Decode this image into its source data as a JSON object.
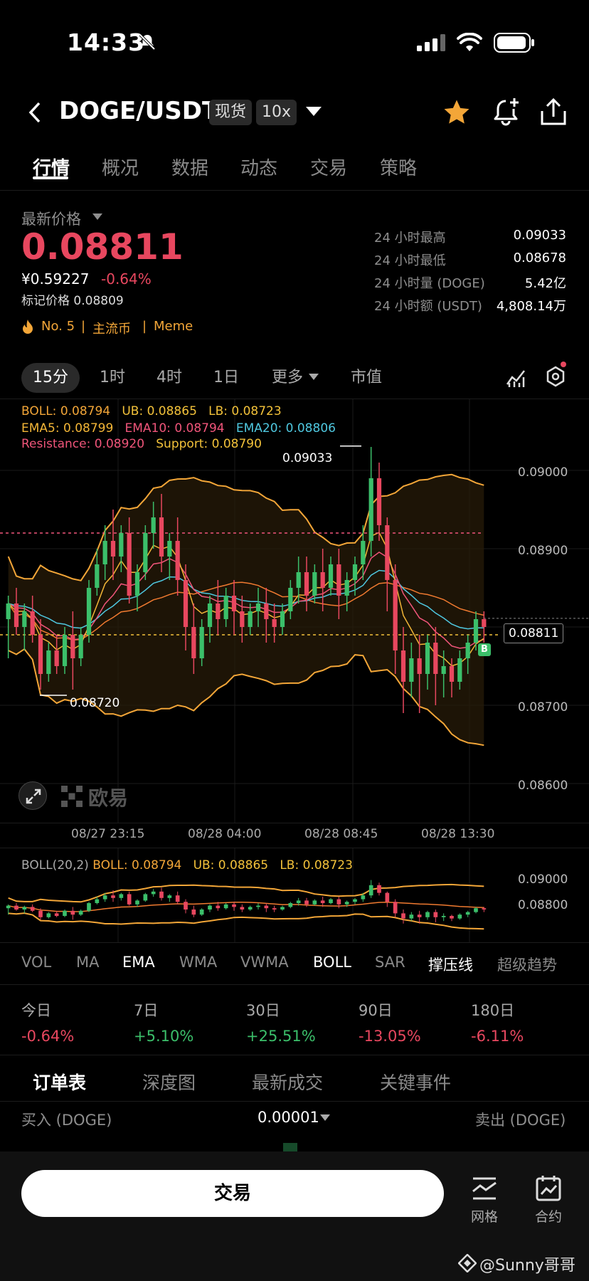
{
  "status_bar": {
    "time": "14:33"
  },
  "header": {
    "pair": "DOGE/USDT",
    "market_chip": "现货",
    "leverage_chip": "10x",
    "favorite_color": "#f3a638"
  },
  "tabs": [
    "行情",
    "概况",
    "数据",
    "动态",
    "交易",
    "策略"
  ],
  "price": {
    "label": "最新价格",
    "last": "0.08811",
    "cny": "¥0.59227",
    "change": "-0.64%",
    "mark_label": "标记价格 0.08809",
    "rank": "No. 5",
    "tag1": "主流币",
    "tag2": "Meme",
    "sep": "|"
  },
  "stats": [
    {
      "k": "24 小时最高",
      "v": "0.09033"
    },
    {
      "k": "24 小时最低",
      "v": "0.08678"
    },
    {
      "k": "24 小时量 (DOGE)",
      "v": "5.42亿"
    },
    {
      "k": "24 小时额 (USDT)",
      "v": "4,808.14万"
    }
  ],
  "timeframes": [
    "15分",
    "1时",
    "4时",
    "1日",
    "更多",
    "市值"
  ],
  "legend": {
    "boll": "BOLL: 0.08794",
    "ub": "UB: 0.08865",
    "lb": "LB: 0.08723",
    "ema5": "EMA5: 0.08799",
    "ema10": "EMA10: 0.08794",
    "ema20": "EMA20: 0.08806",
    "resistance": "Resistance: 0.08920",
    "support": "Support: 0.08790"
  },
  "chart_data": {
    "type": "candlestick",
    "y_ticks": [
      "0.09000",
      "0.08900",
      "0.08800",
      "0.08700",
      "0.08600"
    ],
    "x_ticks": [
      "08/27 23:15",
      "08/28 04:00",
      "08/28 08:45",
      "08/28 13:30"
    ],
    "high_label": "0.09033",
    "low_label": "0.08720",
    "current_price_label": "0.08811",
    "resistance": 0.0892,
    "support": 0.0879,
    "watermark": "欧易",
    "marker": "B",
    "candles": [
      [
        0.0881,
        0.0884,
        0.0883,
        0.0876
      ],
      [
        0.0883,
        0.0885,
        0.088,
        0.0879
      ],
      [
        0.088,
        0.0883,
        0.0882,
        0.0877
      ],
      [
        0.0882,
        0.0884,
        0.0879,
        0.0878
      ],
      [
        0.0879,
        0.0881,
        0.0874,
        0.0872
      ],
      [
        0.0874,
        0.0878,
        0.0877,
        0.0873
      ],
      [
        0.0877,
        0.0879,
        0.0875,
        0.0874
      ],
      [
        0.0875,
        0.088,
        0.0879,
        0.0874
      ],
      [
        0.0879,
        0.0882,
        0.0876,
        0.0872
      ],
      [
        0.0876,
        0.088,
        0.0879,
        0.0875
      ],
      [
        0.0879,
        0.0886,
        0.0885,
        0.0878
      ],
      [
        0.0885,
        0.089,
        0.0888,
        0.0884
      ],
      [
        0.0888,
        0.0893,
        0.0891,
        0.0886
      ],
      [
        0.0891,
        0.0895,
        0.0889,
        0.0886
      ],
      [
        0.0889,
        0.0893,
        0.0892,
        0.0887
      ],
      [
        0.0892,
        0.0894,
        0.0884,
        0.0883
      ],
      [
        0.0884,
        0.0888,
        0.0887,
        0.0882
      ],
      [
        0.0887,
        0.0893,
        0.0892,
        0.0886
      ],
      [
        0.0892,
        0.0896,
        0.0894,
        0.089
      ],
      [
        0.0894,
        0.0897,
        0.0889,
        0.0887
      ],
      [
        0.0889,
        0.0892,
        0.0891,
        0.0886
      ],
      [
        0.0891,
        0.0894,
        0.0886,
        0.0884
      ],
      [
        0.0886,
        0.0888,
        0.088,
        0.0877
      ],
      [
        0.088,
        0.0883,
        0.0876,
        0.0874
      ],
      [
        0.0876,
        0.0881,
        0.088,
        0.0875
      ],
      [
        0.088,
        0.0884,
        0.0883,
        0.0878
      ],
      [
        0.0883,
        0.0886,
        0.0881,
        0.0879
      ],
      [
        0.0881,
        0.0885,
        0.0884,
        0.088
      ],
      [
        0.0884,
        0.0886,
        0.0882,
        0.0879
      ],
      [
        0.0882,
        0.0884,
        0.088,
        0.0878
      ],
      [
        0.088,
        0.0883,
        0.0882,
        0.0879
      ],
      [
        0.0882,
        0.0885,
        0.0883,
        0.088
      ],
      [
        0.0883,
        0.0885,
        0.0881,
        0.0878
      ],
      [
        0.0881,
        0.0883,
        0.088,
        0.0878
      ],
      [
        0.088,
        0.0883,
        0.0882,
        0.0879
      ],
      [
        0.0882,
        0.0886,
        0.0885,
        0.0881
      ],
      [
        0.0885,
        0.0889,
        0.0887,
        0.0883
      ],
      [
        0.0887,
        0.0889,
        0.0884,
        0.0882
      ],
      [
        0.0884,
        0.0888,
        0.0887,
        0.0883
      ],
      [
        0.0887,
        0.089,
        0.0885,
        0.0882
      ],
      [
        0.0885,
        0.0889,
        0.0888,
        0.0884
      ],
      [
        0.0888,
        0.089,
        0.0884,
        0.0881
      ],
      [
        0.0884,
        0.0887,
        0.0886,
        0.0882
      ],
      [
        0.0886,
        0.0889,
        0.0888,
        0.0884
      ],
      [
        0.0888,
        0.0893,
        0.0891,
        0.0886
      ],
      [
        0.0891,
        0.0903,
        0.0899,
        0.0889
      ],
      [
        0.0899,
        0.0901,
        0.0893,
        0.0891
      ],
      [
        0.0893,
        0.0894,
        0.0886,
        0.0882
      ],
      [
        0.0886,
        0.0888,
        0.0877,
        0.0874
      ],
      [
        0.0877,
        0.088,
        0.0873,
        0.0869
      ],
      [
        0.0873,
        0.0878,
        0.0876,
        0.0871
      ],
      [
        0.0876,
        0.0879,
        0.0874,
        0.0869
      ],
      [
        0.0874,
        0.0879,
        0.0878,
        0.0872
      ],
      [
        0.0878,
        0.088,
        0.0874,
        0.087
      ],
      [
        0.0874,
        0.0877,
        0.0875,
        0.0871
      ],
      [
        0.0875,
        0.0876,
        0.0873,
        0.0871
      ],
      [
        0.0873,
        0.0877,
        0.0876,
        0.0872
      ],
      [
        0.0876,
        0.0879,
        0.0878,
        0.0874
      ],
      [
        0.0878,
        0.0882,
        0.0881,
        0.0877
      ],
      [
        0.0881,
        0.0882,
        0.088,
        0.0878
      ]
    ]
  },
  "sub_chart": {
    "boll_title": "BOLL(20,2)",
    "boll": "BOLL: 0.08794",
    "ub": "UB: 0.08865",
    "lb": "LB: 0.08723",
    "y_ticks": [
      "0.09000",
      "0.08800"
    ]
  },
  "indicators": [
    "VOL",
    "MA",
    "EMA",
    "WMA",
    "VWMA",
    "BOLL",
    "SAR",
    "撑压线",
    "超级趋势"
  ],
  "performance": [
    {
      "k": "今日",
      "v": "-0.64%",
      "dir": "down"
    },
    {
      "k": "7日",
      "v": "+5.10%",
      "dir": "up"
    },
    {
      "k": "30日",
      "v": "+25.51%",
      "dir": "up"
    },
    {
      "k": "90日",
      "v": "-13.05%",
      "dir": "down"
    },
    {
      "k": "180日",
      "v": "-6.11%",
      "dir": "down"
    }
  ],
  "orderbook": {
    "tabs": [
      "订单表",
      "深度图",
      "最新成交",
      "关键事件"
    ],
    "buy_label": "买入 (DOGE)",
    "precision": "0.00001",
    "sell_label": "卖出 (DOGE)"
  },
  "bottom_bar": {
    "trade_button": "交易",
    "grid_label": "网格",
    "contract_label": "合约",
    "watermark": "@Sunny哥哥"
  }
}
